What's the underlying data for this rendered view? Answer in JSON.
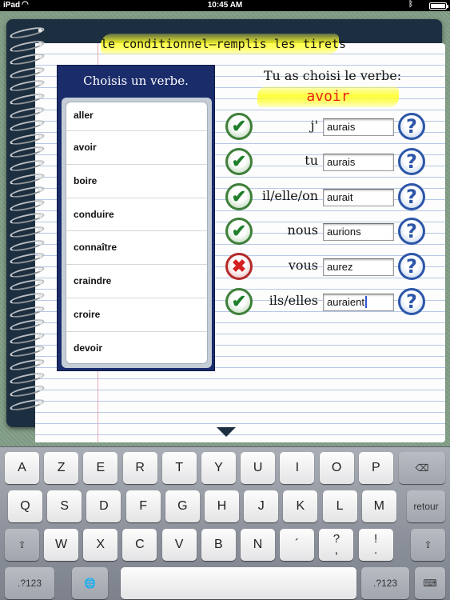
{
  "status_bar": {
    "carrier": "iPad",
    "time": "10:45 AM",
    "battery": "100%",
    "battery_level": 1.0
  },
  "title": "le conditionnel—remplis les tirets",
  "picker": {
    "title": "Choisis un verbe.",
    "verbs": [
      "aller",
      "avoir",
      "boire",
      "conduire",
      "connaître",
      "craindre",
      "croire",
      "devoir"
    ]
  },
  "chosen": {
    "label": "Tu as choisi le verbe:",
    "verb": "avoir"
  },
  "colors": {
    "correct": "#3f7f3a",
    "wrong": "#b32a2a",
    "help": "#2c56a8",
    "verb_text": "#e8221b",
    "highlight": "#ffff33"
  },
  "rows": [
    {
      "pronoun": "j'",
      "answer": "aurais",
      "status": "correct",
      "status_icon": "check-icon"
    },
    {
      "pronoun": "tu",
      "answer": "aurais",
      "status": "correct",
      "status_icon": "check-icon"
    },
    {
      "pronoun": "il/elle/on",
      "answer": "aurait",
      "status": "correct",
      "status_icon": "check-icon"
    },
    {
      "pronoun": "nous",
      "answer": "aurions",
      "status": "correct",
      "status_icon": "check-icon"
    },
    {
      "pronoun": "vous",
      "answer": "aurez",
      "status": "wrong",
      "status_icon": "cross-icon"
    },
    {
      "pronoun": "ils/elles",
      "answer": "auraient",
      "status": "correct",
      "status_icon": "check-icon",
      "focused": true
    }
  ],
  "help_glyph": "?",
  "keyboard": {
    "row1": [
      "A",
      "Z",
      "E",
      "R",
      "T",
      "Y",
      "U",
      "I",
      "O",
      "P"
    ],
    "row2": [
      "Q",
      "S",
      "D",
      "F",
      "G",
      "H",
      "J",
      "K",
      "L",
      "M"
    ],
    "row3": [
      "W",
      "X",
      "C",
      "V",
      "B",
      "N",
      "´"
    ],
    "row3_question": [
      "?",
      ","
    ],
    "row3_period": [
      "!",
      "."
    ],
    "return_label": "retour",
    "numbers_label": ".?123",
    "delete_glyph": "⌫",
    "shift_glyph": "⇧",
    "globe_glyph": "🌐",
    "hide_glyph": "⌨"
  }
}
